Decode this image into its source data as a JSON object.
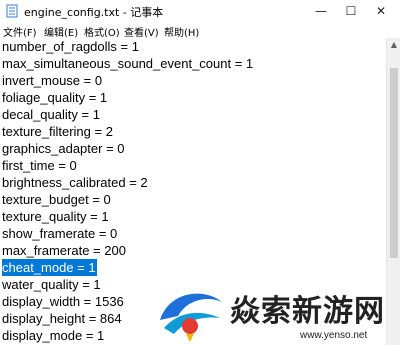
{
  "window": {
    "title": "engine_config.txt - 记事本",
    "controls": [
      "—",
      "☐",
      "✕"
    ]
  },
  "menu": [
    "文件(F)",
    "编辑(E)",
    "格式(O)",
    "查看(V)",
    "帮助(H)"
  ],
  "lines": [
    "number_of_ragdolls = 1",
    "max_simultaneous_sound_event_count = 1",
    "invert_mouse = 0",
    "foliage_quality = 1",
    "decal_quality = 1",
    "texture_filtering = 2",
    "graphics_adapter = 0",
    "first_time = 0",
    "brightness_calibrated = 2",
    "texture_budget = 0",
    "texture_quality = 1",
    "show_framerate = 0",
    "max_framerate = 200",
    "cheat_mode = 1",
    "water_quality = 1",
    "display_width = 1536",
    "display_height = 864",
    "display_mode = 1"
  ],
  "selected_line": "cheat_mode = 1",
  "watermark": {
    "text": "焱索新游网",
    "url": "www.yenso.net",
    "accent_color": "#1e6fd9"
  },
  "colors": {
    "selection": "#0078d7",
    "text": "#000000"
  }
}
